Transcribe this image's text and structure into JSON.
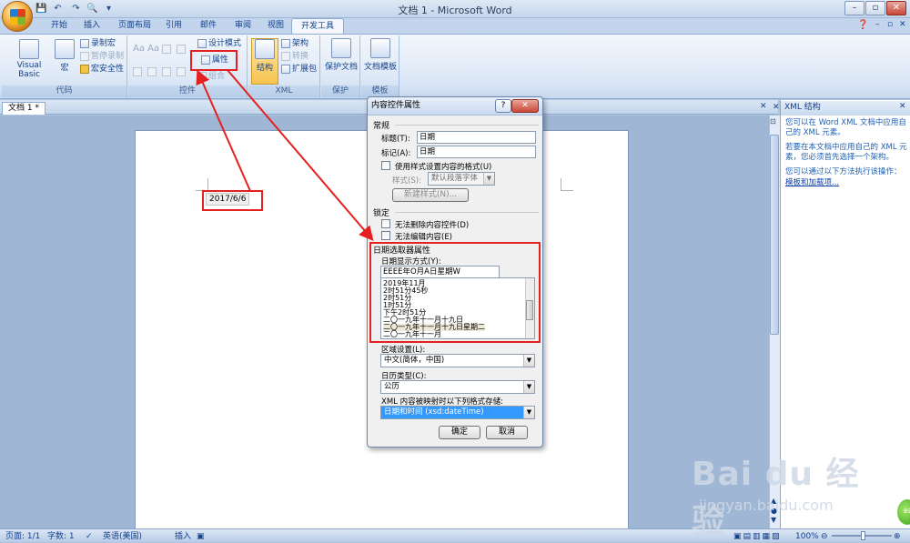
{
  "window": {
    "title": "文档 1 - Microsoft Word"
  },
  "qat": {
    "save": "💾",
    "undo": "↶",
    "redo": "↷",
    "preview": "🔍",
    "more": "▾"
  },
  "tabs": [
    "开始",
    "插入",
    "页面布局",
    "引用",
    "邮件",
    "审阅",
    "视图",
    "开发工具"
  ],
  "ribbon": {
    "code": {
      "label": "代码",
      "vb": "Visual Basic",
      "macro": "宏",
      "record": "录制宏",
      "pause": "暂停录制",
      "security": "宏安全性"
    },
    "controls": {
      "label": "控件",
      "design": "设计模式",
      "props": "属性",
      "group": "组合"
    },
    "xml": {
      "label": "XML",
      "structure": "结构",
      "schema": "架构",
      "transform": "转换",
      "expand": "扩展包"
    },
    "protect": {
      "label": "保护",
      "doc": "保护文档"
    },
    "template": {
      "label": "模板",
      "doc": "文档模板"
    }
  },
  "doc": {
    "tab": "文档 1 *",
    "date": "2017/6/6"
  },
  "xmlpane": {
    "title": "XML 结构",
    "p1": "您可以在 Word XML 文档中应用自己的 XML 元素。",
    "p2": "若要在本文档中应用自己的 XML 元素，您必须首先选择一个架构。",
    "p3": "您可以通过以下方法执行该操作：",
    "link": "模板和加载项..."
  },
  "dialog": {
    "title": "内容控件属性",
    "general": "常规",
    "title_label": "标题(T):",
    "title_val": "日期",
    "tag_label": "标记(A):",
    "tag_val": "日期",
    "use_style": "使用样式设置内容的格式(U)",
    "style_label": "样式(S):",
    "style_val": "默认段落字体",
    "new_style": "新建样式(N)...",
    "lock": "锁定",
    "no_delete": "无法删除内容控件(D)",
    "no_edit": "无法编辑内容(E)",
    "date_props": "日期选取器属性",
    "display_label": "日期显示方式(Y):",
    "display_val": "EEEE年O月A日星期W",
    "formats": [
      "2019年11月",
      "2时51分45秒",
      "2时51分",
      "1时51分",
      "下午2时51分",
      "二〇一九年十一月十九日",
      "二〇一九年十一月十九日星期二",
      "二〇一九年十一月"
    ],
    "locale_label": "区域设置(L):",
    "locale_val": "中文(简体，中国)",
    "calendar_label": "日历类型(C):",
    "calendar_val": "公历",
    "xml_label": "XML 内容被映射时以下列格式存储:",
    "xml_val": "日期和时间 (xsd:dateTime)",
    "ok": "确定",
    "cancel": "取消"
  },
  "status": {
    "page": "页面: 1/1",
    "words": "字数: 1",
    "lang": "英语(美国)",
    "insert": "插入",
    "zoom": "100%"
  },
  "watermark": {
    "logo": "Bai du 经验",
    "url": "jingyan.baidu.com"
  }
}
